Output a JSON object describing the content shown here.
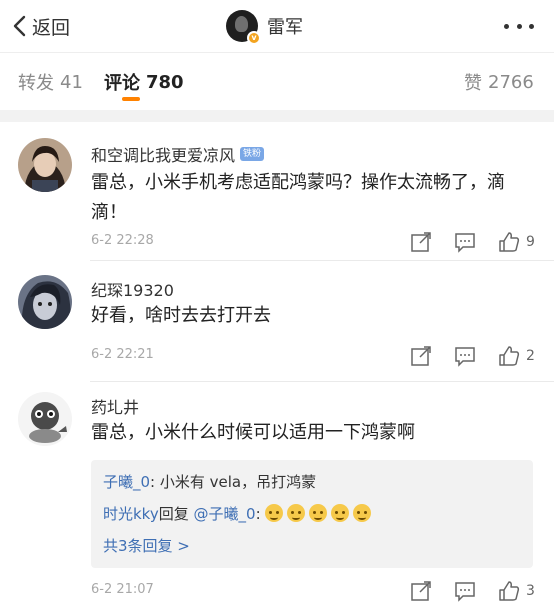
{
  "header": {
    "back_label": "返回",
    "title": "雷军",
    "verified_mark": "v"
  },
  "tabs": {
    "repost_label": "转发",
    "repost_count": "41",
    "comment_label": "评论",
    "comment_count": "780",
    "like_label": "赞",
    "like_count": "2766"
  },
  "colors": {
    "accent": "#ff8200",
    "link": "#3f6fb4",
    "verified": "#f3a420"
  },
  "comments": [
    {
      "user": "和空调比我更爱凉风",
      "badge": "铁粉",
      "text": "雷总，小米手机考虑适配鸿蒙吗？操作太流畅了，滴滴！",
      "time": "6-2 22:28",
      "likes": "9"
    },
    {
      "user": "纪琛19320",
      "text": "好看，啥时去去打开去",
      "time": "6-2 22:21",
      "likes": "2"
    },
    {
      "user": "药圠井",
      "text": "雷总，小米什么时候可以适用一下鸿蒙啊",
      "time": "6-2 21:07",
      "likes": "3",
      "replies": [
        {
          "user": "子曦_0",
          "sep": ": ",
          "text": "小米有 vela，吊打鸿蒙"
        },
        {
          "user": "时光kky",
          "mid": "回复",
          "target": "@子曦_0",
          "sep": ":",
          "emoji_count": 5
        }
      ],
      "more_replies": "共3条回复 >"
    }
  ],
  "icons": [
    "chevron-left-icon",
    "more-icon",
    "share-icon",
    "comment-icon",
    "like-icon",
    "emoji-icon"
  ]
}
